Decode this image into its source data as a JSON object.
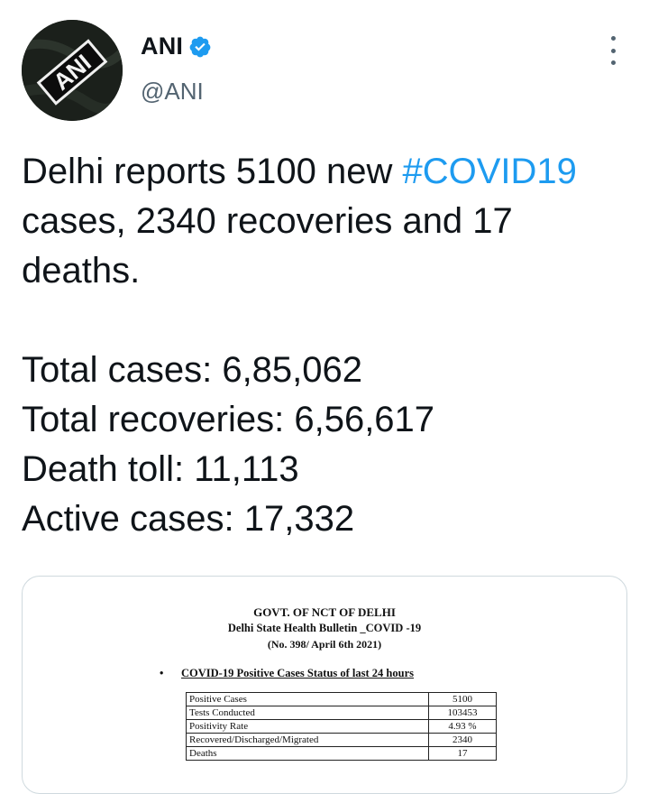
{
  "author": {
    "name": "ANI",
    "handle": "@ANI",
    "verified": true,
    "avatar_logo_text": "ANI"
  },
  "more_icon": "more-vertical-icon",
  "tweet": {
    "line1_prefix": "Delhi reports 5100 new ",
    "hashtag": "#COVID19",
    "line2": "cases, 2340 recoveries and 17",
    "line3": "deaths.",
    "stats": [
      "Total cases: 6,85,062",
      "Total recoveries: 6,56,617",
      "Death toll: 11,113",
      "Active cases: 17,332"
    ]
  },
  "bulletin": {
    "header1": "GOVT. OF NCT OF DELHI",
    "header2": "Delhi State Health Bulletin _COVID -19",
    "header3": "(No. 398/ April 6th 2021)",
    "bullet_symbol": "•",
    "section_title": "COVID-19 Positive Cases Status of last 24 hours",
    "rows": [
      {
        "label": "Positive Cases",
        "value": "5100"
      },
      {
        "label": "Tests Conducted",
        "value": "103453"
      },
      {
        "label": "Positivity Rate",
        "value": "4.93 %"
      },
      {
        "label": "Recovered/Discharged/Migrated",
        "value": "2340"
      },
      {
        "label": "Deaths",
        "value": "17"
      }
    ]
  },
  "colors": {
    "link": "#1d9bf0",
    "text": "#0f1419",
    "secondary": "#536471"
  }
}
